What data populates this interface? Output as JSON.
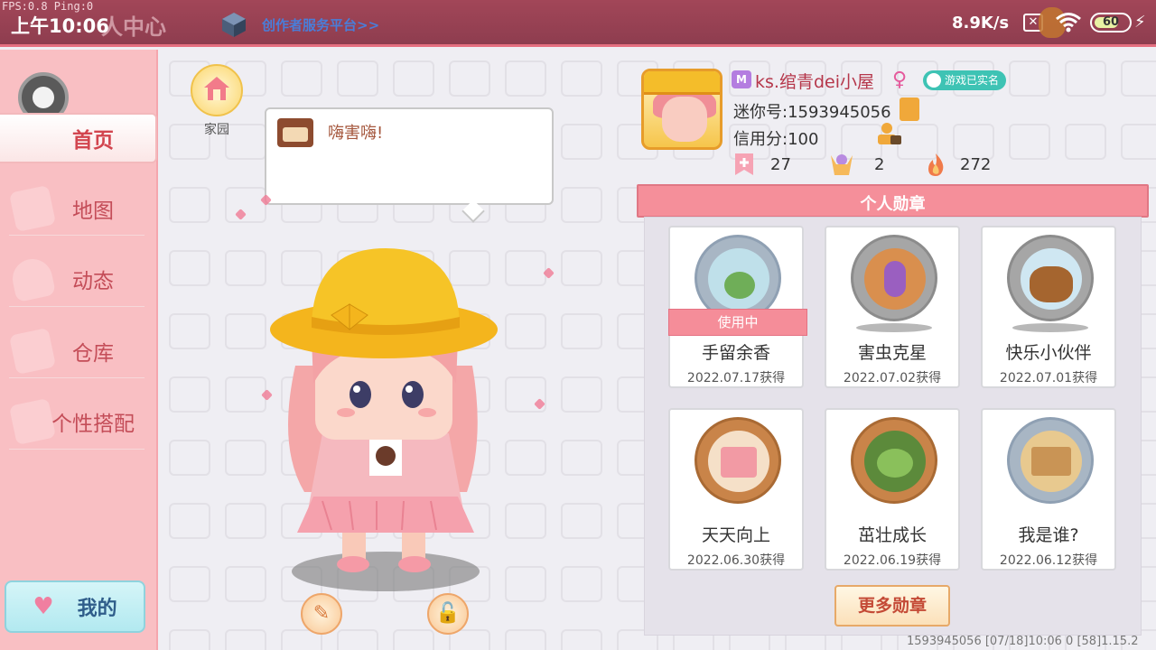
{
  "status_bar": {
    "fps_text": "FPS:0.8  Ping:0",
    "clock": "上午10:06",
    "title_ghost": "人中心",
    "creator_link": "创作者服务平台>>",
    "net_speed": "8.9K/s",
    "sim_icon_text": "✕",
    "battery_level": "60"
  },
  "sidebar": {
    "items": [
      {
        "label": "首页",
        "active": true
      },
      {
        "label": "地图"
      },
      {
        "label": "动态"
      },
      {
        "label": "仓库"
      },
      {
        "label": "个性搭配"
      }
    ],
    "mine_label": "我的"
  },
  "center": {
    "home_label": "家园",
    "speech_text": "嗨害嗨!"
  },
  "profile": {
    "nickname": "ks.绾青dei小屋",
    "realname_badge": "游戏已实名",
    "mini_id": "迷你号:1593945056",
    "credit": "信用分:100",
    "stats": [
      {
        "icon": "bookmark-plus-icon",
        "value": "27"
      },
      {
        "icon": "cheer-icon",
        "value": "2"
      },
      {
        "icon": "flame-icon",
        "value": "272"
      }
    ]
  },
  "medals": {
    "header": "个人勋章",
    "in_use_label": "使用中",
    "items": [
      {
        "name": "手留余香",
        "date": "2022.07.17获得",
        "in_use": true,
        "ring": "#a8b6c4",
        "inner": "#bfe0ea"
      },
      {
        "name": "害虫克星",
        "date": "2022.07.02获得",
        "in_use": false,
        "ring": "#a6a6a6",
        "inner": "#d98f4e"
      },
      {
        "name": "快乐小伙伴",
        "date": "2022.07.01获得",
        "in_use": false,
        "ring": "#a6a6a6",
        "inner": "#cfe7f2"
      },
      {
        "name": "天天向上",
        "date": "2022.06.30获得",
        "in_use": false,
        "ring": "#c98449",
        "inner": "#f5e0c8"
      },
      {
        "name": "茁壮成长",
        "date": "2022.06.19获得",
        "in_use": false,
        "ring": "#c98449",
        "inner": "#5c8a3b"
      },
      {
        "name": "我是谁?",
        "date": "2022.06.12获得",
        "in_use": false,
        "ring": "#a8b6c4",
        "inner": "#e8c98f"
      }
    ],
    "more_label": "更多勋章"
  },
  "footer": {
    "info": "1593945056    [07/18]10:06 0  [58]1.15.2"
  }
}
